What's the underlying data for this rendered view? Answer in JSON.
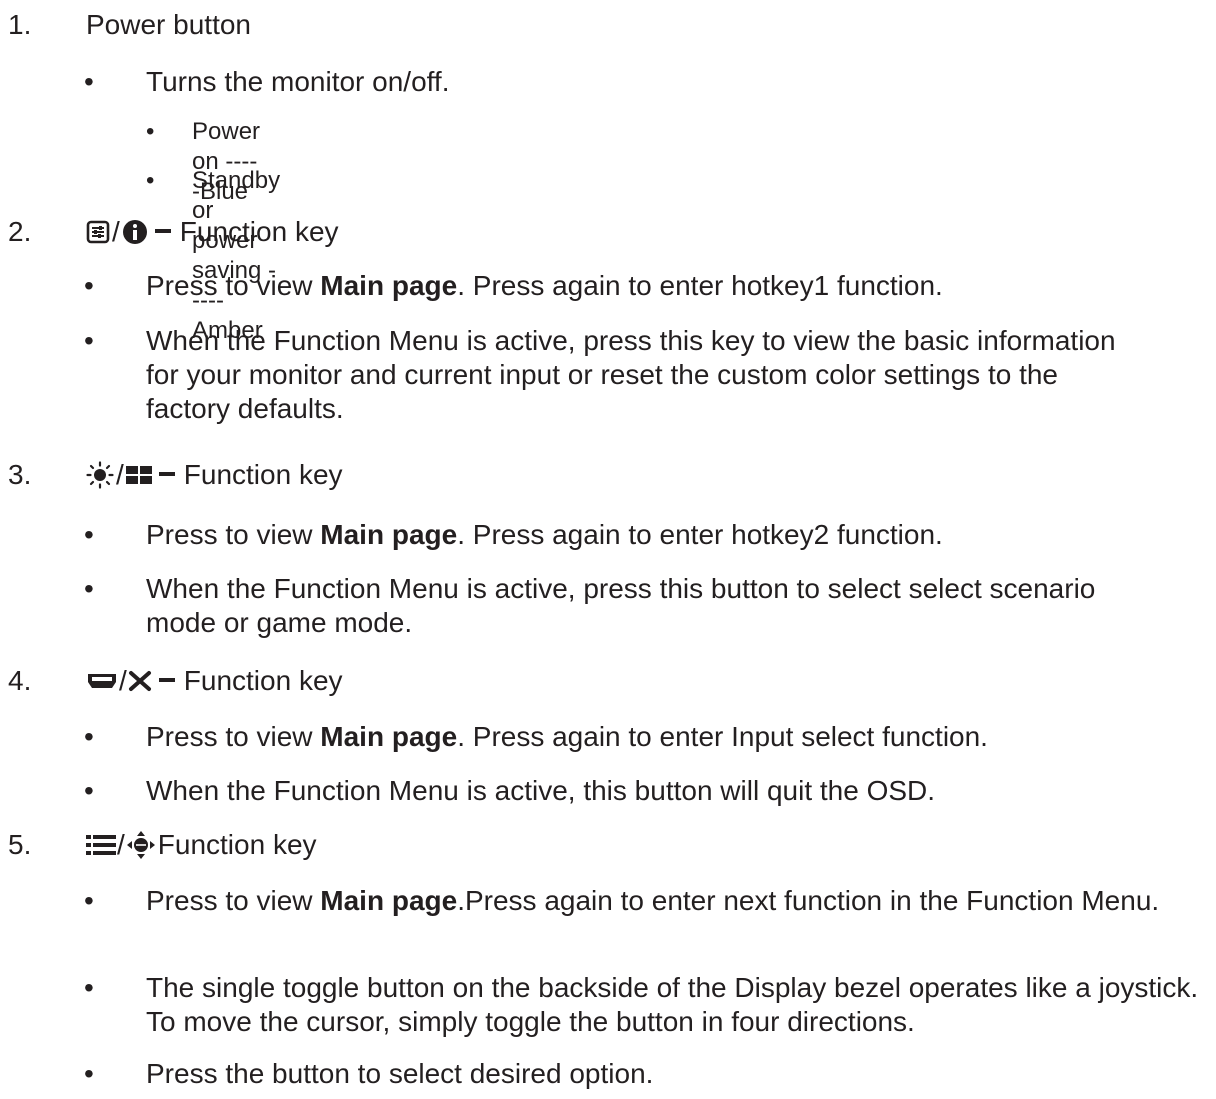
{
  "items": [
    {
      "number": "1.",
      "title": "Power button",
      "bullets": [
        {
          "text": "Turns the monitor on/off."
        }
      ],
      "sub_bullets": [
        {
          "text": "Power on -----Blue"
        },
        {
          "text": "Standby or power saving -----Amber"
        }
      ]
    },
    {
      "number": "2.",
      "title": "Function key",
      "icons": [
        "settings-panel-icon",
        "info-icon",
        "dash-icon"
      ],
      "bullets": [
        {
          "pre": "Press to view ",
          "bold": "Main page",
          "post": ". Press again to enter hotkey1 function."
        },
        {
          "text": "When the Function Menu is active, press this key to view the basic information for your monitor and current input or reset the custom color settings to the factory defaults."
        }
      ]
    },
    {
      "number": "3.",
      "title": "Function key",
      "icons": [
        "brightness-icon",
        "grid-icon",
        "dash-icon"
      ],
      "bullets": [
        {
          "pre": "Press to view ",
          "bold": "Main page",
          "post": ". Press again to enter hotkey2 function."
        },
        {
          "text": "When the Function Menu is active, press this button to select select scenario mode or game mode."
        }
      ]
    },
    {
      "number": "4.",
      "title": "Function key",
      "icons": [
        "input-port-icon",
        "close-icon",
        "dash-icon"
      ],
      "bullets": [
        {
          "pre": "Press to view ",
          "bold": "Main page",
          "post": ". Press again to enter Input select function."
        },
        {
          "text": "When the Function Menu is active, this button will quit the OSD."
        }
      ]
    },
    {
      "number": "5.",
      "title": "Function key",
      "icons": [
        "menu-list-icon",
        "joystick-icon"
      ],
      "bullets": [
        {
          "pre": "Press to view ",
          "bold": "Main page",
          "post": ".Press again to enter next function in the Function Menu."
        },
        {
          "text": "The single toggle button on the backside of the Display bezel operates like a joystick. To move the cursor, simply toggle the button in four directions."
        },
        {
          "text": "Press the button to select desired option."
        }
      ]
    }
  ],
  "bullet_char": "•",
  "separator": "/"
}
